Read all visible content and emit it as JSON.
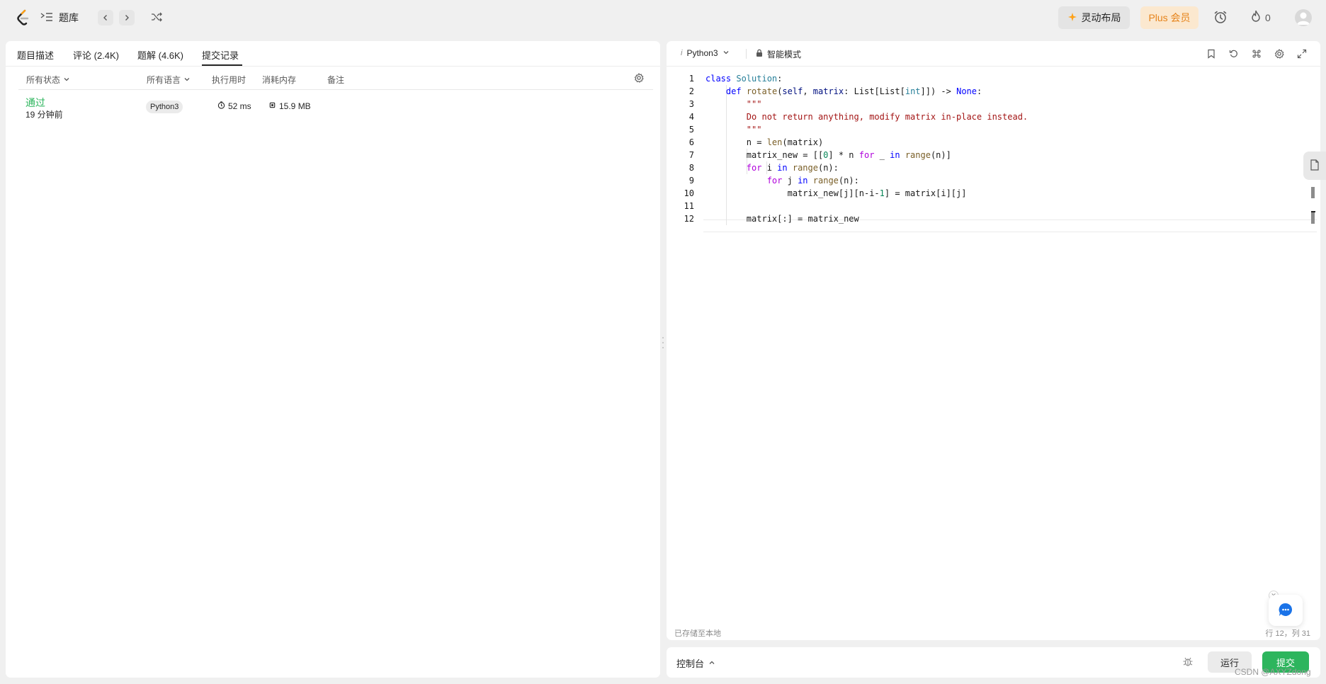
{
  "topbar": {
    "problem_list_label": "题库",
    "layout_button_label": "灵动布局",
    "plus_button_label": "Plus 会员",
    "streak_count": "0"
  },
  "left_panel": {
    "tabs": [
      {
        "label": "题目描述"
      },
      {
        "label": "评论 (2.4K)"
      },
      {
        "label": "题解 (4.6K)"
      },
      {
        "label": "提交记录"
      }
    ],
    "active_tab": "提交记录",
    "filters": {
      "status": "所有状态",
      "language": "所有语言",
      "runtime": "执行用时",
      "memory": "消耗内存",
      "notes": "备注"
    },
    "submissions": [
      {
        "status": "通过",
        "time": "19 分钟前",
        "language": "Python3",
        "runtime": "52 ms",
        "memory": "15.9 MB"
      }
    ]
  },
  "editor": {
    "language": "Python3",
    "mode_label": "智能模式",
    "line_numbers": [
      "1",
      "2",
      "3",
      "4",
      "5",
      "6",
      "7",
      "8",
      "9",
      "10",
      "11",
      "12"
    ],
    "saved_note": "已存储至本地",
    "cursor_position": "行 12，列 31",
    "current_line": 12
  },
  "console": {
    "label": "控制台",
    "run_label": "运行",
    "submit_label": "提交"
  },
  "watermark": "CSDN @AXYZdong",
  "colors": {
    "accept_green": "#2db55d",
    "plus_orange": "#e6831a",
    "keyword_blue": "#0000ff",
    "string_red": "#a31515"
  }
}
